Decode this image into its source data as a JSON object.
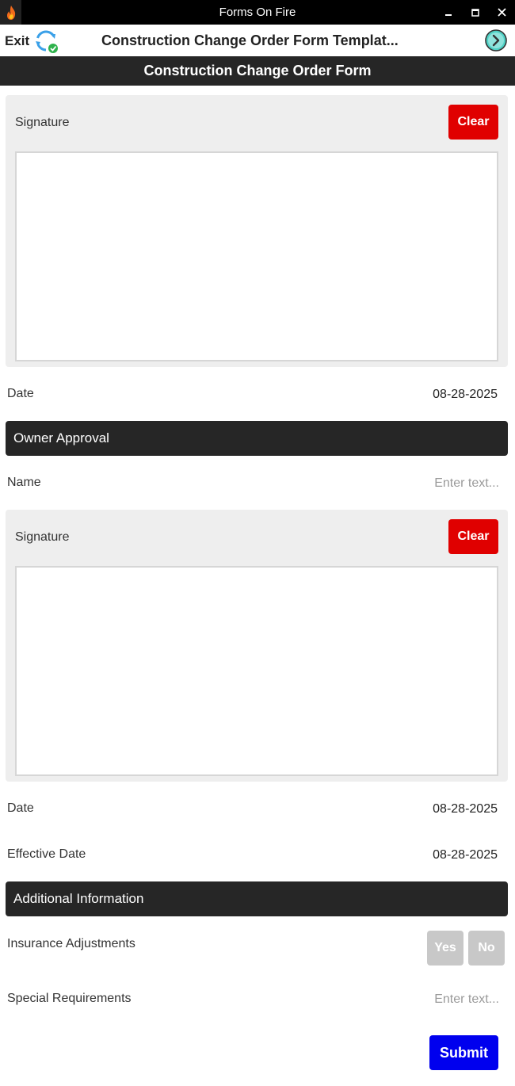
{
  "window": {
    "title": "Forms On Fire",
    "app_icon": "flame-icon",
    "controls": {
      "minimize": "▁",
      "maximize": "▢",
      "close": "✕"
    }
  },
  "header": {
    "exit_label": "Exit",
    "sync_icon": "sync-icon",
    "title": "Construction Change Order Form Templat...",
    "next_icon": "chevron-right-circle-icon"
  },
  "form": {
    "title": "Construction Change Order Form"
  },
  "signature_1": {
    "label": "Signature",
    "clear_label": "Clear"
  },
  "date_1": {
    "label": "Date",
    "value": "08-28-2025"
  },
  "owner_section": {
    "title": "Owner Approval"
  },
  "owner_name": {
    "label": "Name",
    "placeholder": "Enter text..."
  },
  "signature_2": {
    "label": "Signature",
    "clear_label": "Clear"
  },
  "date_2": {
    "label": "Date",
    "value": "08-28-2025"
  },
  "effective_date": {
    "label": "Effective Date",
    "value": "08-28-2025"
  },
  "additional_section": {
    "title": "Additional Information"
  },
  "insurance": {
    "label": "Insurance Adjustments",
    "yes_label": "Yes",
    "no_label": "No"
  },
  "special": {
    "label": "Special Requirements",
    "placeholder": "Enter text..."
  },
  "submit_label": "Submit",
  "colors": {
    "clear_button": "#e00000",
    "submit_button": "#0000ee",
    "section_band": "#262626",
    "toggle_inactive": "#c8c8c8"
  }
}
